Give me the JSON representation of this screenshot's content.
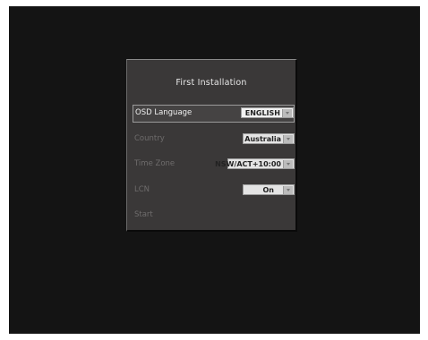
{
  "dialog": {
    "title": "First Installation",
    "rows": [
      {
        "label": "OSD Language",
        "value": "ENGLISH",
        "icon": "chevron-down-icon"
      },
      {
        "label": "Country",
        "value": "Australia",
        "icon": "chevron-down-icon"
      },
      {
        "label": "Time Zone",
        "value": "NSW/ACT+10:00",
        "icon": "chevron-down-icon"
      },
      {
        "label": "LCN",
        "value": "On",
        "icon": "chevron-down-icon"
      },
      {
        "label": "Start"
      }
    ]
  },
  "colors": {
    "screen_background": "#141414",
    "dialog_background": "#3a3838",
    "selected_text": "#f0f0f0",
    "dimmed_text": "#6e6c6c"
  }
}
